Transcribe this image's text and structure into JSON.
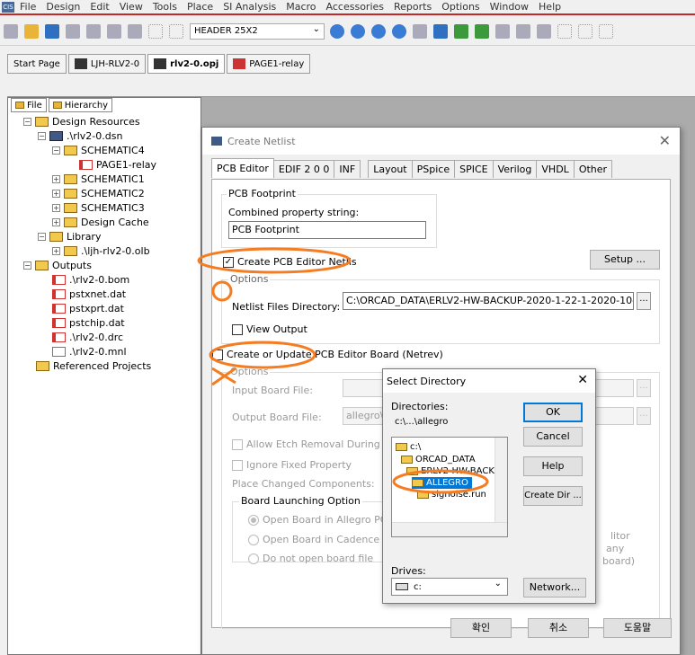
{
  "menu": {
    "items": [
      "File",
      "Design",
      "Edit",
      "View",
      "Tools",
      "Place",
      "SI Analysis",
      "Macro",
      "Accessories",
      "Reports",
      "Options",
      "Window",
      "Help"
    ]
  },
  "toolbar": {
    "part_value": "HEADER 25X2"
  },
  "doc_tabs": [
    {
      "label": "Start Page"
    },
    {
      "label": "LJH-RLV2-0"
    },
    {
      "label": "rlv2-0.opj"
    },
    {
      "label": "PAGE1-relay"
    }
  ],
  "project_panel": {
    "tabs": [
      "File",
      "Hierarchy"
    ],
    "tree": [
      {
        "label": "Design Resources"
      },
      {
        "label": ".\\rlv2-0.dsn"
      },
      {
        "label": "SCHEMATIC4"
      },
      {
        "label": "PAGE1-relay"
      },
      {
        "label": "SCHEMATIC1"
      },
      {
        "label": "SCHEMATIC2"
      },
      {
        "label": "SCHEMATIC3"
      },
      {
        "label": "Design Cache"
      },
      {
        "label": "Library"
      },
      {
        "label": ".\\ljh-rlv2-0.olb"
      },
      {
        "label": "Outputs"
      },
      {
        "label": ".\\rlv2-0.bom"
      },
      {
        "label": "pstxnet.dat"
      },
      {
        "label": "pstxprt.dat"
      },
      {
        "label": "pstchip.dat"
      },
      {
        "label": ".\\rlv2-0.drc"
      },
      {
        "label": ".\\rlv2-0.mnl"
      },
      {
        "label": "Referenced Projects"
      }
    ]
  },
  "dialog": {
    "title": "Create Netlist",
    "tabs": [
      "PCB Editor",
      "EDIF 2 0 0",
      "INF",
      "Layout",
      "PSpice",
      "SPICE",
      "Verilog",
      "VHDL",
      "Other"
    ],
    "footprint_group": "PCB Footprint",
    "combined_label": "Combined property string:",
    "combined_value": "PCB Footprint",
    "create_netlist_label": "Create PCB Editor Netlis",
    "setup_button": "Setup ...",
    "options_label": "Options",
    "netlist_dir_label": "Netlist Files Directory:",
    "netlist_dir_value": "C:\\ORCAD_DATA\\ERLV2-HW-BACKUP-2020-1-22-1-2020-10-",
    "browse": "...",
    "view_output_label": "View Output",
    "create_board_label": "Create or Update PCB Editor Board (Netrev)",
    "options2_label": "Options",
    "input_board_label": "Input Board File:",
    "output_board_label": "Output Board File:",
    "output_board_value": "allegro\\",
    "allow_etch_label": "Allow Etch Removal During EC",
    "ignore_fixed_label": "Ignore Fixed Property",
    "place_changed_label": "Place Changed Components:",
    "launching_group": "Board Launching Option",
    "radio_open_allegro": "Open Board in Allegro PCB",
    "radio_open_cadence": "Open Board in Cadence SiP",
    "radio_no_open": "Do not open board file",
    "partial_text1": "litor",
    "partial_text2": "any",
    "partial_text3": "board)",
    "ok_button": "확인",
    "cancel_button": "취소",
    "help_button": "도움말"
  },
  "select_directory": {
    "title": "Select Directory",
    "directories_label": "Directories:",
    "current_path": "c:\\...\\allegro",
    "dirs": [
      "c:\\",
      "ORCAD_DATA",
      "ERLV2-HW-BACK",
      "ALLEGRO",
      "signoise.run"
    ],
    "drives_label": "Drives:",
    "drive_value": "c:",
    "ok_button": "OK",
    "cancel_button": "Cancel",
    "help_button": "Help",
    "create_dir_button": "Create Dir ...",
    "network_button": "Network..."
  },
  "colors": {
    "annotation": "#f57c20",
    "selection": "#0078d7"
  }
}
